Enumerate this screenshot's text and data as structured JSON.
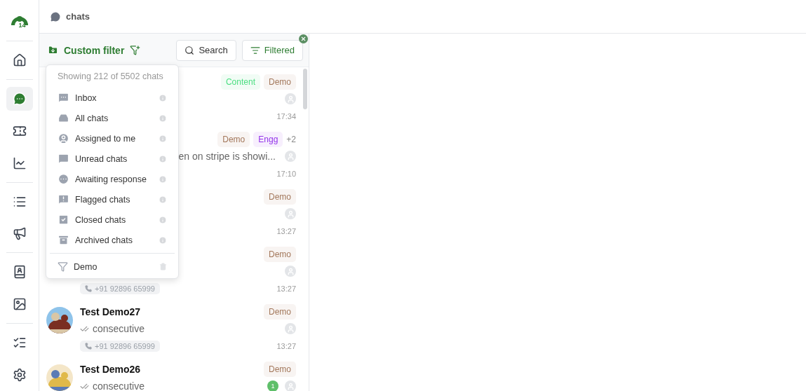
{
  "sidebar": {
    "items": [
      {
        "selected": false
      },
      {
        "selected": true
      },
      {
        "selected": false
      },
      {
        "selected": false
      },
      {
        "selected": false
      },
      {
        "selected": false
      },
      {
        "selected": false
      },
      {
        "selected": false
      },
      {
        "selected": false
      },
      {
        "selected": false
      }
    ]
  },
  "logo": {
    "badge": "14"
  },
  "breadcrumb": {
    "label": "chats"
  },
  "filter_bar": {
    "title": "Custom filter",
    "search_button": "Search",
    "filtered_button": "Filtered"
  },
  "dropdown": {
    "summary": "Showing 212 of 5502 chats",
    "items": [
      {
        "label": "Inbox"
      },
      {
        "label": "All chats"
      },
      {
        "label": "Assigned to me"
      },
      {
        "label": "Unread chats"
      },
      {
        "label": "Awaiting response"
      },
      {
        "label": "Flagged chats"
      },
      {
        "label": "Closed chats"
      },
      {
        "label": "Archived chats"
      }
    ],
    "custom_filters": [
      {
        "label": "Demo"
      }
    ]
  },
  "chats": [
    {
      "tags": [
        {
          "label": "Content",
          "color": "#4ade80"
        },
        {
          "label": "Demo",
          "color": "#a3785c"
        }
      ],
      "time": "17:34"
    },
    {
      "tags": [
        {
          "label": "Demo",
          "color": "#a3785c"
        },
        {
          "label": "Engg",
          "color": "#9333ea"
        }
      ],
      "more_tags": "+2",
      "preview": "en on stripe is showi...",
      "time": "17:10"
    },
    {
      "tags": [
        {
          "label": "Demo",
          "color": "#a3785c"
        }
      ],
      "time": "13:27"
    },
    {
      "tags": [
        {
          "label": "Demo",
          "color": "#a3785c"
        }
      ],
      "phone": "+91 92896 65999",
      "time": "13:27"
    },
    {
      "name": "Test Demo27",
      "tags": [
        {
          "label": "Demo",
          "color": "#a3785c"
        }
      ],
      "preview": "consecutive",
      "phone": "+91 92896 65999",
      "time": "13:27"
    },
    {
      "name": "Test Demo26",
      "tags": [
        {
          "label": "Demo",
          "color": "#a3785c"
        }
      ],
      "preview": "consecutive",
      "unread": "1"
    }
  ]
}
